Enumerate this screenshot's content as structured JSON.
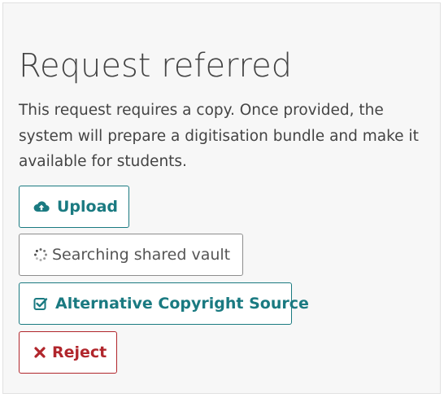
{
  "page": {
    "title": "Request referred",
    "description": "This request requires a copy. Once provided, the system will prepare a digitisation bundle and make it available for students."
  },
  "actions": {
    "upload": {
      "label": "Upload",
      "icon": "cloud-upload-icon",
      "color": "#1a7a81"
    },
    "searching": {
      "label": "Searching shared vault",
      "icon": "spinner-icon",
      "color": "#555555"
    },
    "alternative": {
      "label": "Alternative Copyright Source",
      "icon": "checkbox-checked-icon",
      "color": "#1a7a81"
    },
    "reject": {
      "label": "Reject",
      "icon": "x-mark-icon",
      "color": "#b1262c"
    }
  },
  "colors": {
    "panel_background": "#f7f7f7",
    "text": "#444444",
    "accent": "#1a7a81",
    "danger": "#b1262c"
  }
}
